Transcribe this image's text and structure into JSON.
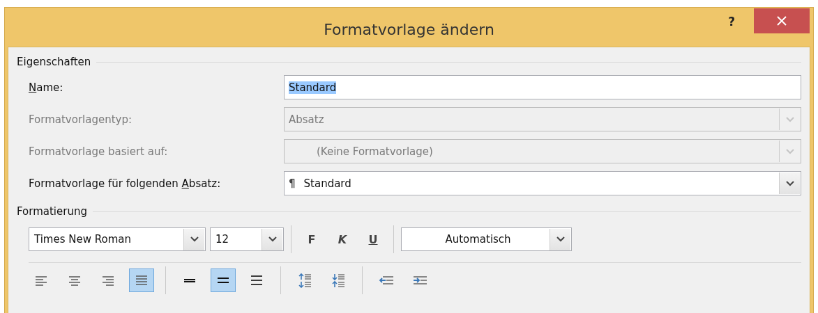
{
  "window": {
    "title": "Formatvorlage ändern",
    "help": "?"
  },
  "properties": {
    "heading": "Eigenschaften",
    "fields": [
      {
        "label": {
          "key": "N",
          "after": "ame:"
        },
        "kind": "text",
        "value": "Standard",
        "value_selected": true,
        "disabled": false
      },
      {
        "label": {
          "before": "Formatvorlagentyp:"
        },
        "kind": "select",
        "value": "Absatz",
        "disabled": true
      },
      {
        "label": {
          "before": "Formatvorlage basiert auf:"
        },
        "kind": "select",
        "value": "(Keine Formatvorlage)",
        "indent": true,
        "disabled": true
      },
      {
        "label": {
          "before": "Formatvorlage für folgenden ",
          "key": "A",
          "after": "bsatz:"
        },
        "kind": "select",
        "value": "Standard",
        "mark": "¶",
        "disabled": false
      }
    ]
  },
  "formatting": {
    "heading": "Formatierung",
    "font": "Times New Roman",
    "size": "12",
    "styles": [
      {
        "kind": "bold",
        "label": "F"
      },
      {
        "kind": "italic",
        "label": "K"
      },
      {
        "kind": "underline",
        "label": "U"
      }
    ],
    "font_color": "Automatisch",
    "groups": [
      [
        {
          "kind": "align-left",
          "selected": false
        },
        {
          "kind": "align-center",
          "selected": false
        },
        {
          "kind": "align-right",
          "selected": false
        },
        {
          "kind": "justify",
          "selected": true
        }
      ],
      [
        {
          "kind": "single-spacing",
          "selected": false
        },
        {
          "kind": "one-half-spacing",
          "selected": true
        },
        {
          "kind": "double-spacing",
          "selected": false
        }
      ],
      [
        {
          "kind": "increase-paragraph-spacing",
          "selected": false
        },
        {
          "kind": "decrease-paragraph-spacing",
          "selected": false
        }
      ],
      [
        {
          "kind": "decrease-indent",
          "selected": false
        },
        {
          "kind": "increase-indent",
          "selected": false
        }
      ]
    ]
  }
}
